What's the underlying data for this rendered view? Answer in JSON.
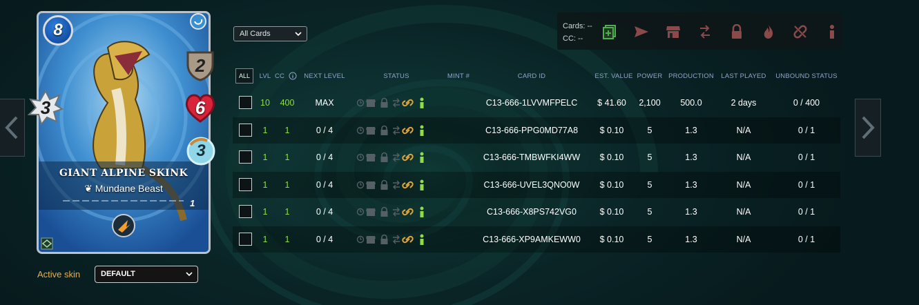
{
  "card": {
    "name": "GIANT ALPINE SKINK",
    "type": "Mundane Beast",
    "level": "1",
    "mana": "8",
    "armor": "2",
    "health": "6",
    "melee": "3",
    "speed": "3"
  },
  "skin": {
    "label": "Active skin",
    "value": "DEFAULT"
  },
  "filter": {
    "value": "All Cards"
  },
  "actions": {
    "cards_label": "Cards: --",
    "cc_label": "CC: --",
    "icons": [
      "add-to-deck-icon",
      "send-icon",
      "market-icon",
      "transfer-icon",
      "lock-icon",
      "burn-icon",
      "unlink-icon",
      "info-icon"
    ]
  },
  "table": {
    "all_label": "ALL",
    "headers": {
      "lvl": "LVL",
      "cc": "CC",
      "next_level": "NEXT LEVEL",
      "status": "STATUS",
      "mint": "MINT #",
      "card_id": "CARD ID",
      "est_value": "EST. VALUE",
      "power": "POWER",
      "production": "PRODUCTION",
      "last_played": "LAST PLAYED",
      "unbound": "UNBOUND STATUS"
    },
    "rows": [
      {
        "lvl": "10",
        "cc": "400",
        "next": "MAX",
        "id": "C13-666-1LVVMFPELC",
        "value": "$ 41.60",
        "power": "2,100",
        "prod": "500.0",
        "played": "2 days",
        "unbound": "0 / 400"
      },
      {
        "lvl": "1",
        "cc": "1",
        "next": "0 / 4",
        "id": "C13-666-PPG0MD77A8",
        "value": "$ 0.10",
        "power": "5",
        "prod": "1.3",
        "played": "N/A",
        "unbound": "0 / 1"
      },
      {
        "lvl": "1",
        "cc": "1",
        "next": "0 / 4",
        "id": "C13-666-TMBWFKI4WW",
        "value": "$ 0.10",
        "power": "5",
        "prod": "1.3",
        "played": "N/A",
        "unbound": "0 / 1"
      },
      {
        "lvl": "1",
        "cc": "1",
        "next": "0 / 4",
        "id": "C13-666-UVEL3QNO0W",
        "value": "$ 0.10",
        "power": "5",
        "prod": "1.3",
        "played": "N/A",
        "unbound": "0 / 1"
      },
      {
        "lvl": "1",
        "cc": "1",
        "next": "0 / 4",
        "id": "C13-666-X8PS742VG0",
        "value": "$ 0.10",
        "power": "5",
        "prod": "1.3",
        "played": "N/A",
        "unbound": "0 / 1"
      },
      {
        "lvl": "1",
        "cc": "1",
        "next": "0 / 4",
        "id": "C13-666-XP9AMKEWW0",
        "value": "$ 0.10",
        "power": "5",
        "prod": "1.3",
        "played": "N/A",
        "unbound": "0 / 1"
      }
    ]
  },
  "colors": {
    "green": "#8edc4a",
    "link_gold": "#e0a53a",
    "header_blue": "#8fa6c8",
    "skin_label": "#e8b04a"
  }
}
